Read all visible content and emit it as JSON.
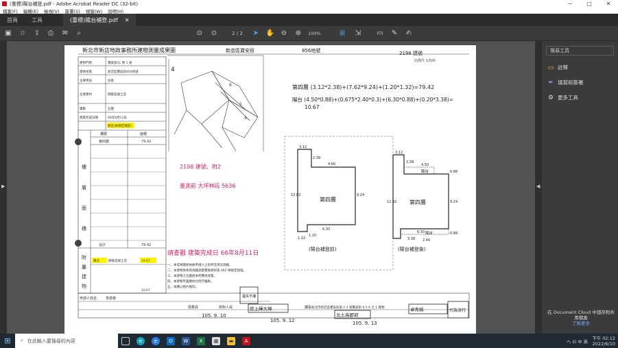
{
  "window": {
    "title": "(重標)陽台補登.pdf - Adobe Acrobat Reader DC (32-bit)",
    "controls": [
      "─",
      "□",
      "✕"
    ]
  },
  "menu": [
    "檔案(F)",
    "編輯(E)",
    "檢視(V)",
    "簽署(S)",
    "視窗(W)",
    "說明(H)"
  ],
  "tabs": {
    "home": "首頁",
    "tools": "工具",
    "doc": "(重標)陽台補登.pdf",
    "doc_close": "✕"
  },
  "toolbar": {
    "page_current": "2",
    "page_sep": "/",
    "page_total": "2",
    "zoom": "100%"
  },
  "side_panel": {
    "search_placeholder": "搜尋工具",
    "items": [
      {
        "label": "註釋",
        "icon": "comment-icon"
      },
      {
        "label": "填寫和簽署",
        "icon": "fill-sign-icon"
      },
      {
        "label": "更多工具",
        "icon": "more-tools-icon"
      }
    ],
    "cloud_text": "在 Document Cloud 中儲存和共用檔案",
    "cloud_link": "了解更多"
  },
  "taskbar": {
    "search_placeholder": "在此輸入要搜尋的內容",
    "tray_text": "へ ⊡ 中 英",
    "time": "下午 02:12",
    "date": "2022/6/10"
  },
  "document": {
    "header_left": "新北市新店地政事務所建物測量成果圖",
    "header_mid": "新店區寶安段",
    "header_mid2": "856地號",
    "header_right": "2198 建號",
    "scale_small": "比例尺 1/500",
    "calc_line1": "第四層 (3.12*2.38)+(7.62*9.24)+(1.20*1.32)=79.42",
    "calc_line2": "陽台 (4.50*0.88)+(0.675*2.40*0.3)+(6.30*0.88)+(0.20*3.38)=",
    "calc_line2b": "10.67",
    "plan1_label": "第四層",
    "plan2_label": "第四層",
    "plan2_balcony": "陽台",
    "plan2_balcony2": "陽台",
    "plan1_caption": "(陽台補登前)",
    "plan2_caption": "(陽台補登後)",
    "dims": {
      "d312": "3.12",
      "d238": "2.38",
      "d460": "4.60",
      "d1282": "12.82",
      "d924": "9.24",
      "d630": "6.30",
      "d132": "1.32",
      "d120": "1.20",
      "d450": "4.50",
      "d088": "0.88",
      "d338": "3.38",
      "d240": "2.40"
    },
    "handnote1": "2198 建號、附2",
    "handnote2": "量測前 大坪林段 5636",
    "handnote3": "請查戳 建築完成日 66年8月11日",
    "area_total": "79.42",
    "balcony_area": "10.67",
    "balcony_area2": "10.67",
    "yellow_note": "陽台(依規定補登)",
    "left_vertical": [
      "樓",
      "層",
      "面",
      "積"
    ],
    "left_vertical2": [
      "附",
      "屬",
      "建",
      "物"
    ],
    "table_rows": [
      {
        "k": "建物門牌",
        "v": "寶安街41 巷 1 號"
      },
      {
        "k": "建物坐落",
        "v": "新店區寶安段856地號"
      },
      {
        "k": "主要用途",
        "v": "住家"
      },
      {
        "k": "主要建材",
        "v": "鋼筋混凝土造"
      },
      {
        "k": "層數",
        "v": "五層"
      },
      {
        "k": "建築完成日期",
        "v": "66年8月11日"
      }
    ],
    "col_floor": "樓層",
    "col_area": "面積",
    "floor_4": "第四層",
    "total_label": "合計",
    "annex_label": "陽台",
    "annex_material": "鋼筋混凝土造",
    "notes": [
      "一、本成果圖係依據申請人之指界及現況測繪。",
      "二、本建物係依照地籍測量實施規則第 282 條規定辦理。",
      "三、本建物之位置經本所實地測量。",
      "四、本建物平面圖依比例尺繪製。",
      "五、本圖以相片縮印。"
    ],
    "sign_applicant": "申請人姓名",
    "sign_applicant_v": "李振泰",
    "sign_surveyor": "測量員",
    "sign_checker": "校對人員",
    "sign_chief": "課長",
    "sign_name1": "莊上輝大璋",
    "sign_name2": "北土高郡郭",
    "sign_name3": "卓秀娟",
    "sign_date1": "105. 9. 10",
    "sign_date2": "105. 9. 12",
    "sign_date3": "105. 9. 13",
    "stamp_1": "代為決行",
    "stamp_2": "遺失不補",
    "address_line": "新北市新店區寶安段第 2 4 號寶安街 8 5 6 之 1 建物"
  }
}
